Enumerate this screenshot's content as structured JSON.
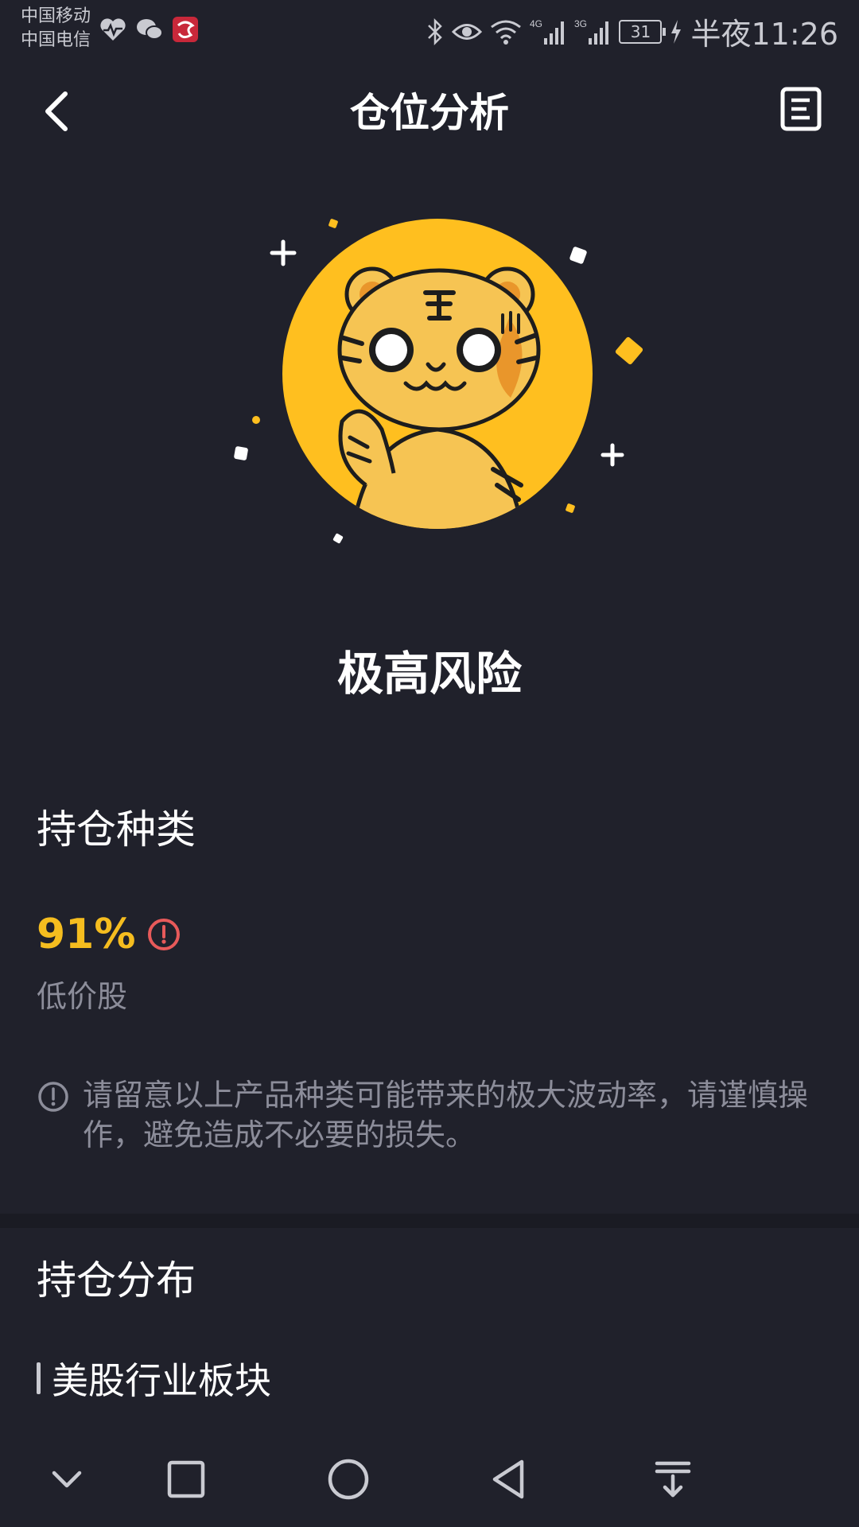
{
  "status_bar": {
    "carrier_1": "中国移动",
    "carrier_2": "中国电信",
    "battery": "31",
    "time": "半夜11:26",
    "network_1": "4G",
    "network_2": "3G"
  },
  "header": {
    "title": "仓位分析",
    "back_icon": "chevron-left-icon",
    "report_icon": "document-list-icon"
  },
  "hero": {
    "mascot": "tiger-mascot",
    "circle_color": "#ffbf1f"
  },
  "risk": {
    "level": "极高风险"
  },
  "holdings_type": {
    "title": "持仓种类",
    "percent": "91%",
    "stock_type": "低价股",
    "warning_color": "#e85a5a",
    "accent_color": "#f5bd1f",
    "notice": "请留意以上产品种类可能带来的极大波动率，请谨慎操作，避免造成不必要的损失。"
  },
  "holdings_distribution": {
    "title": "持仓分布",
    "subsection_title": "美股行业板块"
  },
  "bottom_nav": {
    "items": [
      "chevron-down-icon",
      "square-icon",
      "circle-icon",
      "triangle-back-icon",
      "download-icon"
    ]
  }
}
